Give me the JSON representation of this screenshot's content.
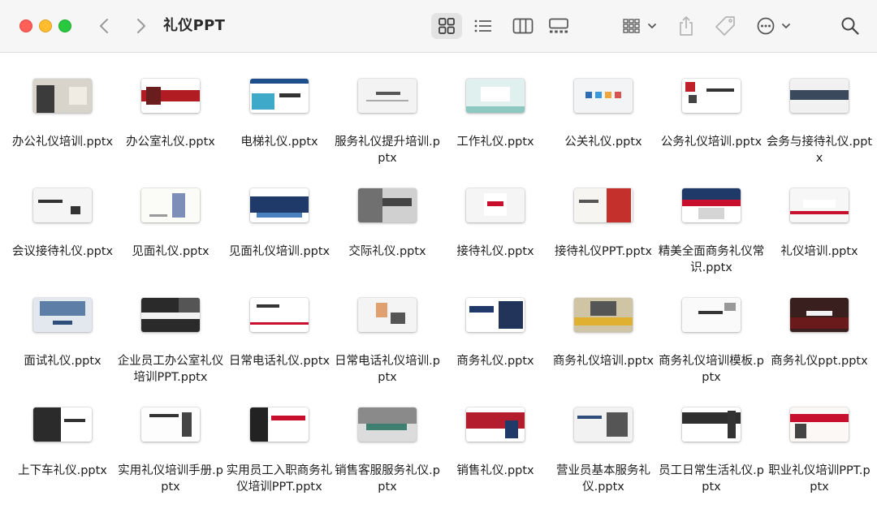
{
  "window": {
    "title": "礼仪PPT"
  },
  "toolbar": {
    "icons": [
      "chevron-left-icon",
      "chevron-right-icon",
      "icon-view-icon",
      "list-view-icon",
      "column-view-icon",
      "gallery-view-icon",
      "group-by-icon",
      "share-icon",
      "tag-icon",
      "more-icon",
      "search-icon"
    ]
  },
  "files": [
    {
      "name": "办公礼仪培训.pptx"
    },
    {
      "name": "办公室礼仪.pptx"
    },
    {
      "name": "电梯礼仪.pptx"
    },
    {
      "name": "服务礼仪提升培训.pptx"
    },
    {
      "name": "工作礼仪.pptx"
    },
    {
      "name": "公关礼仪.pptx"
    },
    {
      "name": "公务礼仪培训.pptx"
    },
    {
      "name": "会务与接待礼仪.pptx"
    },
    {
      "name": "会议接待礼仪.pptx"
    },
    {
      "name": "见面礼仪.pptx"
    },
    {
      "name": "见面礼仪培训.pptx"
    },
    {
      "name": "交际礼仪.pptx"
    },
    {
      "name": "接待礼仪.pptx"
    },
    {
      "name": "接待礼仪PPT.pptx"
    },
    {
      "name": "精美全面商务礼仪常识.pptx"
    },
    {
      "name": "礼仪培训.pptx"
    },
    {
      "name": "面试礼仪.pptx"
    },
    {
      "name": "企业员工办公室礼仪培训PPT.pptx"
    },
    {
      "name": "日常电话礼仪.pptx"
    },
    {
      "name": "日常电话礼仪培训.pptx"
    },
    {
      "name": "商务礼仪.pptx"
    },
    {
      "name": "商务礼仪培训.pptx"
    },
    {
      "name": "商务礼仪培训模板.pptx"
    },
    {
      "name": "商务礼仪ppt.pptx"
    },
    {
      "name": "上下车礼仪.pptx"
    },
    {
      "name": "实用礼仪培训手册.pptx"
    },
    {
      "name": "实用员工入职商务礼仪培训PPT.pptx"
    },
    {
      "name": "销售客服服务礼仪.pptx"
    },
    {
      "name": "销售礼仪.pptx"
    },
    {
      "name": "营业员基本服务礼仪.pptx"
    },
    {
      "name": "员工日常生活礼仪.pptx"
    },
    {
      "name": "职业礼仪培训PPT.pptx"
    }
  ],
  "colors": {
    "accent": "#c8102e",
    "navy": "#1f3a68",
    "selected_view": "#e3e3e3"
  }
}
